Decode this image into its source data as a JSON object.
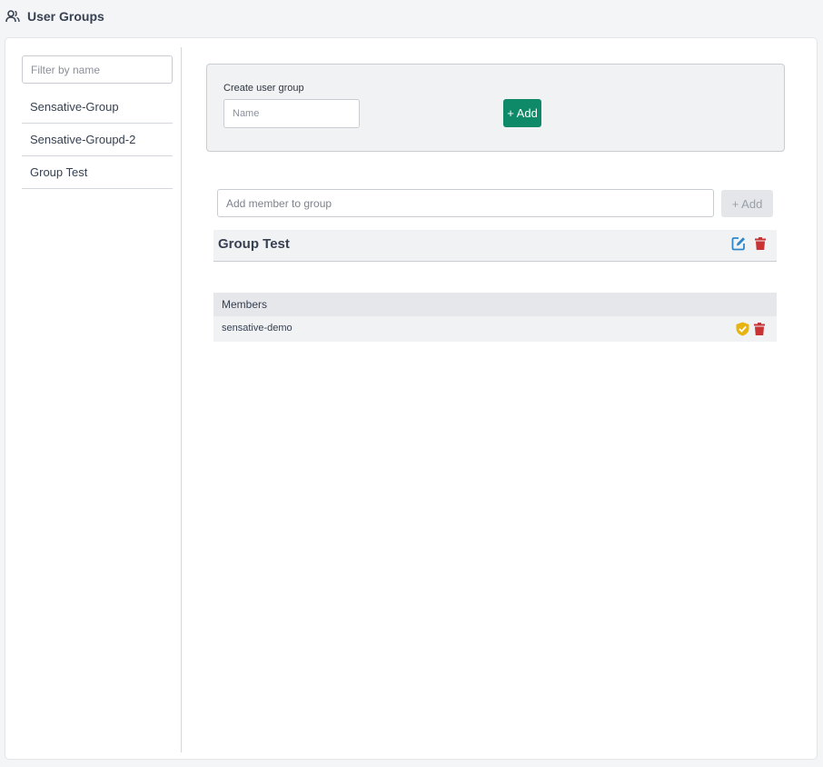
{
  "header": {
    "title": "User Groups",
    "icon": "users-icon"
  },
  "sidebar": {
    "filter_placeholder": "Filter by name",
    "groups": [
      {
        "label": "Sensative-Group"
      },
      {
        "label": "Sensative-Groupd-2"
      },
      {
        "label": "Group Test"
      }
    ]
  },
  "create": {
    "label": "Create user group",
    "name_placeholder": "Name",
    "add_label": "+ Add"
  },
  "member_form": {
    "placeholder": "Add member to group",
    "add_label": "+ Add"
  },
  "selected_group": {
    "name": "Group Test",
    "edit_icon": "edit-icon",
    "delete_icon": "trash-icon"
  },
  "members": {
    "header": "Members",
    "rows": [
      {
        "name": "sensative-demo",
        "admin_icon": "shield-check-icon",
        "delete_icon": "trash-icon"
      }
    ]
  },
  "colors": {
    "accent_green": "#0f8a68",
    "edit_blue": "#2f86c8",
    "delete_red": "#c83333",
    "admin_yellow": "#e8b40f"
  }
}
